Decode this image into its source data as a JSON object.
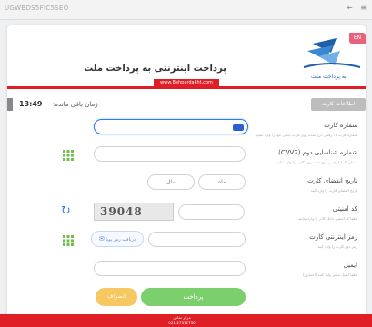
{
  "browser": {
    "url_text": "UGWBDS5FIC5SEO",
    "icons": [
      "download-icon",
      "menu-icon"
    ]
  },
  "header": {
    "title": "پرداخت اینترنتی به پرداخت ملت",
    "link_text": "www.Behpardakht.com",
    "lang_badge": "EN",
    "accent_color": "#e01e26"
  },
  "timer": {
    "label": "زمان باقی مانده:",
    "value": "13:49"
  },
  "panel": {
    "heading": "اطلاعات کارت",
    "fields": [
      {
        "label": "شماره کارت",
        "hint": "شماره کارت ۱۶ رقمی درج شده روی کارت بانکی خود را وارد نمایید"
      },
      {
        "label": "شماره شناسایی دوم (CVV2)",
        "hint": "شماره ۳ یا ۴ رقمی درج شده روی کارت را وارد نمایید"
      },
      {
        "label": "تاریخ انقضای کارت",
        "hint": "تاریخ انقضای کارت را وارد کنید"
      },
      {
        "label": "کد امنیتی",
        "hint": "لطفا کد امنیتی داخل کادر را وارد نمایید"
      },
      {
        "label": "رمز اینترنتی کارت",
        "hint": "رمز دوم کارت را وارد کنید"
      },
      {
        "label": "ایمیل",
        "hint": "لطفا ایمیل معتبر وارد کنید (اختیاری)"
      }
    ]
  },
  "form": {
    "month_placeholder": "ماه",
    "year_placeholder": "سال",
    "captcha_text": "39048",
    "otp_button": "دریافت رمز پویا",
    "pay_button": "پرداخت",
    "cancel_button": "انصراف"
  },
  "footer": {
    "line1": "مرکز تماس",
    "line2": "021-27312730"
  }
}
